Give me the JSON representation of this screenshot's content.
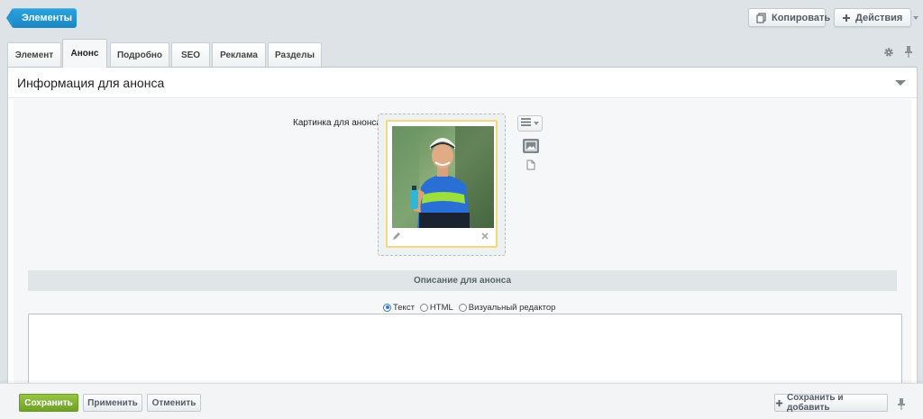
{
  "toolbar": {
    "back_label": "Элементы",
    "copy_label": "Копировать",
    "actions_label": "Действия"
  },
  "tabs": [
    {
      "label": "Элемент",
      "active": false
    },
    {
      "label": "Анонс",
      "active": true
    },
    {
      "label": "Подробно",
      "active": false
    },
    {
      "label": "SEO",
      "active": false
    },
    {
      "label": "Реклама",
      "active": false
    },
    {
      "label": "Разделы",
      "active": false
    }
  ],
  "panel": {
    "title": "Информация для анонса",
    "image_field_label": "Картинка для анонса:",
    "description_header": "Описание для анонса",
    "editor_modes": [
      {
        "label": "Текст",
        "checked": true
      },
      {
        "label": "HTML",
        "checked": false
      },
      {
        "label": "Визуальный редактор",
        "checked": false
      }
    ],
    "description_value": ""
  },
  "footer": {
    "save_label": "Сохранить",
    "apply_label": "Применить",
    "cancel_label": "Отменить",
    "save_add_label": "Сохранить и добавить"
  },
  "colors": {
    "accent_blue": "#1a85c3",
    "save_green": "#6ea126",
    "image_border": "#f4d97a"
  }
}
